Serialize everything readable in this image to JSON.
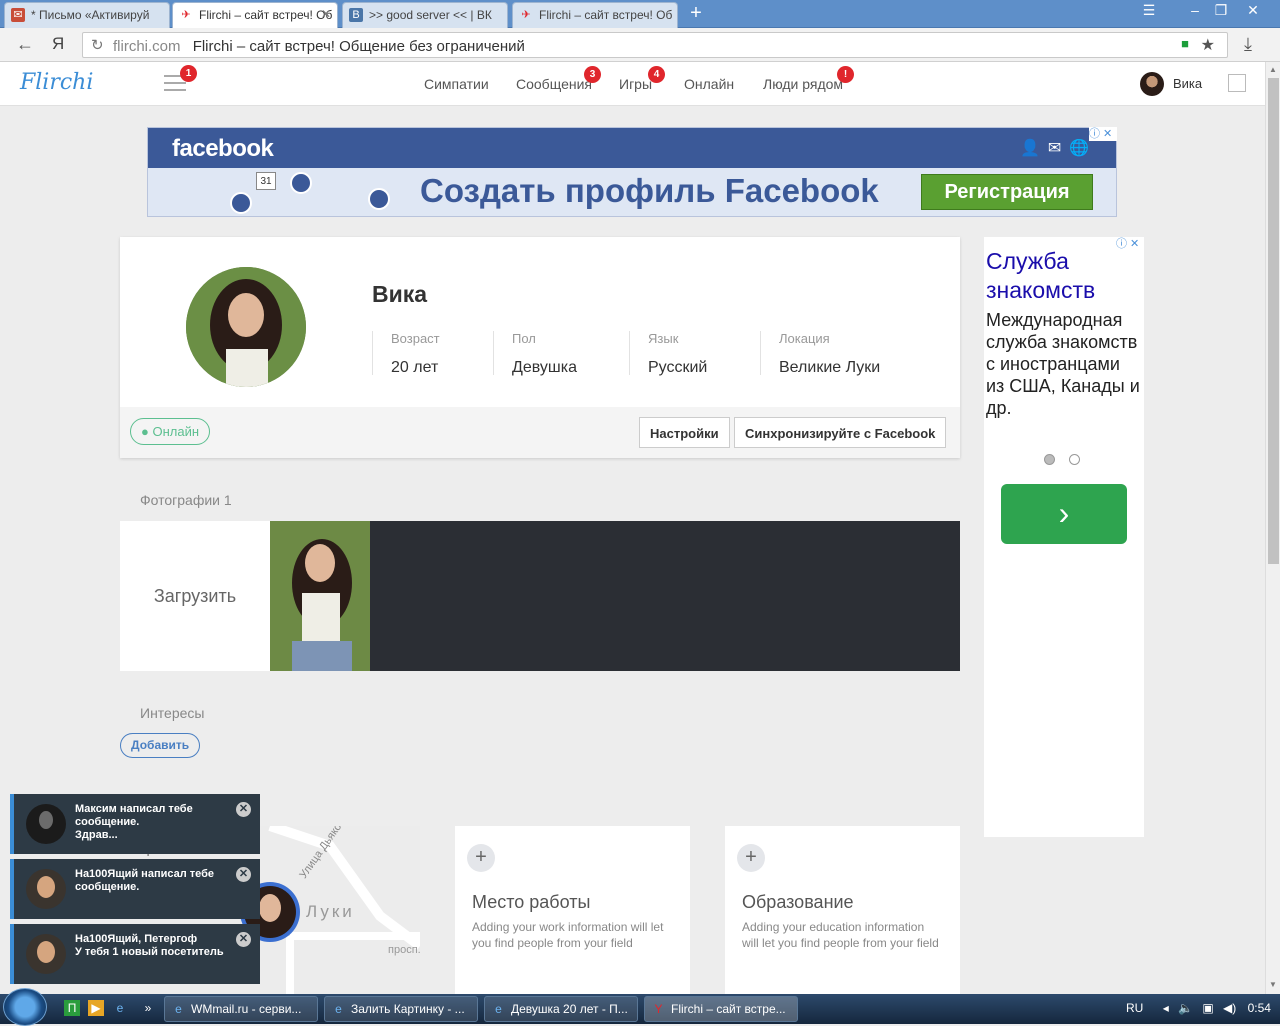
{
  "browser": {
    "tabs": [
      {
        "label": "* Письмо «Активируй",
        "icon": "mail-icon",
        "color": "#c84d39"
      },
      {
        "label": "Flirchi – сайт встреч! Об",
        "icon": "flirchi-icon",
        "color": "#e0262c"
      },
      {
        "label": ">> good server << | ВК",
        "icon": "vk-icon",
        "color": "#4a76a8"
      },
      {
        "label": "Flirchi – сайт встреч! Об",
        "icon": "flirchi-icon",
        "color": "#e0262c"
      }
    ],
    "new_tab": "+",
    "search_letter": "Я",
    "url_host": "flirchi.com",
    "url_title": "Flirchi – сайт встреч! Общение без ограничений"
  },
  "header": {
    "logo": "Flirchi",
    "menu_badge": "1",
    "nav": [
      {
        "label": "Симпатии",
        "badge": ""
      },
      {
        "label": "Сообщения",
        "badge": "3"
      },
      {
        "label": "Игры",
        "badge": "4"
      },
      {
        "label": "Онлайн",
        "badge": ""
      },
      {
        "label": "Люди рядом",
        "badge": "!"
      }
    ],
    "user_name": "Вика"
  },
  "fb_ad": {
    "brand": "facebook",
    "calendar_day": "31",
    "slogan": "Создать профиль Facebook",
    "button": "Регистрация",
    "ad_marks": "ⓘ ✕",
    "brand_color": "#3b5998"
  },
  "profile": {
    "name": "Вика",
    "fields": [
      {
        "label": "Возраст",
        "value": "20 лет"
      },
      {
        "label": "Пол",
        "value": "Девушка"
      },
      {
        "label": "Язык",
        "value": "Русский"
      },
      {
        "label": "Локация",
        "value": "Великие Луки"
      }
    ],
    "status": "● Онлайн",
    "settings_button": "Настройки",
    "sync_button": "Синхронизируйте с Facebook"
  },
  "photos": {
    "title": "Фотографии 1",
    "upload": "Загрузить"
  },
  "interests": {
    "title": "Интересы",
    "add_button": "Добавить"
  },
  "right_ad": {
    "title": "Служба знакомств",
    "text": "Международная служба знакомств с иностранцами из США, Канады и др.",
    "ad_marks": "ⓘ ✕",
    "arrow": "›"
  },
  "map": {
    "street": "Улица Дьяконо",
    "city": "Луки",
    "side": "просп.",
    "zoom_in": "+",
    "zoom_out": "−"
  },
  "info_boxes": [
    {
      "title": "Место работы",
      "desc": "Adding your work information will let you find people from your field"
    },
    {
      "title": "Образование",
      "desc": "Adding your education information will let you find people from your field"
    }
  ],
  "notifications": [
    {
      "text": "Максим написал тебе сообщение.\nЗдрав..."
    },
    {
      "text": "На100Ящий написал тебе сообщение."
    },
    {
      "text": "На100Ящий, Петергоф\nУ тебя 1 новый посетитель"
    }
  ],
  "taskbar": {
    "items": [
      {
        "label": "WMmail.ru - серви..."
      },
      {
        "label": "Залить Картинку - ..."
      },
      {
        "label": "Девушка 20 лет - П..."
      },
      {
        "label": "Flirchi – сайт встре..."
      }
    ],
    "lang": "RU",
    "time": "0:54"
  }
}
